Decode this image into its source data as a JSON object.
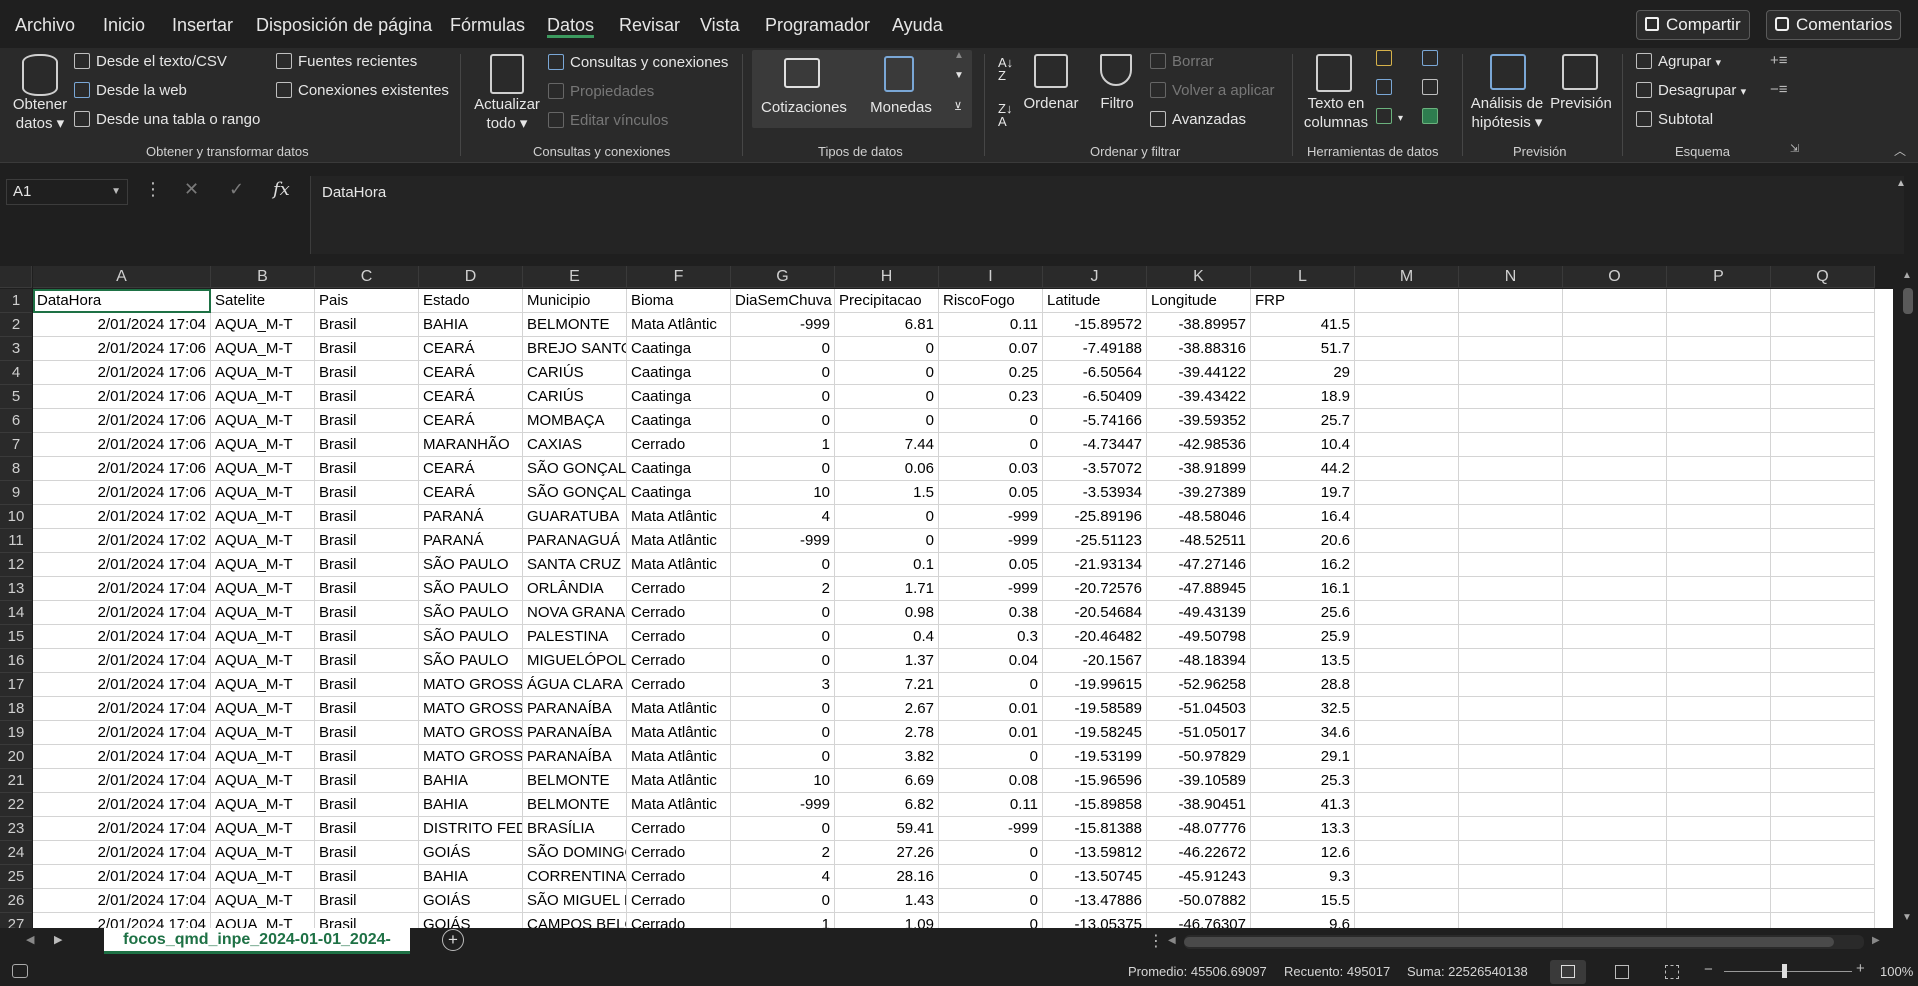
{
  "menu": {
    "tabs": [
      "Archivo",
      "Inicio",
      "Insertar",
      "Disposición de página",
      "Fórmulas",
      "Datos",
      "Revisar",
      "Vista",
      "Programador",
      "Ayuda"
    ],
    "share": "Compartir",
    "comments": "Comentarios"
  },
  "ribbon": {
    "get_data": [
      "Obtener",
      "datos"
    ],
    "from_text": "Desde el texto/CSV",
    "from_web": "Desde la web",
    "from_table": "Desde una tabla o rango",
    "recent_sources": "Fuentes recientes",
    "existing_connections": "Conexiones existentes",
    "group_get_transform": "Obtener y transformar datos",
    "refresh_all": [
      "Actualizar",
      "todo"
    ],
    "queries_connections": "Consultas y conexiones",
    "properties": "Propiedades",
    "edit_links": "Editar vínculos",
    "group_queries": "Consultas y conexiones",
    "stocks": "Cotizaciones",
    "currencies": "Monedas",
    "group_data_types": "Tipos de datos",
    "sort": "Ordenar",
    "filter": "Filtro",
    "clear": "Borrar",
    "reapply": "Volver a aplicar",
    "advanced": "Avanzadas",
    "group_sort_filter": "Ordenar y filtrar",
    "text_to_columns": [
      "Texto en",
      "columnas"
    ],
    "group_data_tools": "Herramientas de datos",
    "what_if": [
      "Análisis de",
      "hipótesis"
    ],
    "forecast_sheet": "Previsión",
    "group_forecast": "Previsión",
    "group_btn": "Agrupar",
    "ungroup_btn": "Desagrupar",
    "subtotal": "Subtotal",
    "group_outline": "Esquema"
  },
  "formula_bar": {
    "name_box": "A1",
    "content": "DataHora"
  },
  "columns": [
    "A",
    "B",
    "C",
    "D",
    "E",
    "F",
    "G",
    "H",
    "I",
    "J",
    "K",
    "L",
    "M",
    "N",
    "O",
    "P",
    "Q"
  ],
  "table": {
    "headers": [
      "DataHora",
      "Satelite",
      "Pais",
      "Estado",
      "Municipio",
      "Bioma",
      "DiaSemChuva",
      "Precipitacao",
      "RiscoFogo",
      "Latitude",
      "Longitude",
      "FRP"
    ],
    "rows": [
      [
        "2/01/2024 17:04",
        "AQUA_M-T",
        "Brasil",
        "BAHIA",
        "BELMONTE",
        "Mata Atlântic",
        "-999",
        "6.81",
        "0.11",
        "-15.89572",
        "-38.89957",
        "41.5"
      ],
      [
        "2/01/2024 17:06",
        "AQUA_M-T",
        "Brasil",
        "CEARÁ",
        "BREJO SANTO",
        "Caatinga",
        "0",
        "0",
        "0.07",
        "-7.49188",
        "-38.88316",
        "51.7"
      ],
      [
        "2/01/2024 17:06",
        "AQUA_M-T",
        "Brasil",
        "CEARÁ",
        "CARIÚS",
        "Caatinga",
        "0",
        "0",
        "0.25",
        "-6.50564",
        "-39.44122",
        "29"
      ],
      [
        "2/01/2024 17:06",
        "AQUA_M-T",
        "Brasil",
        "CEARÁ",
        "CARIÚS",
        "Caatinga",
        "0",
        "0",
        "0.23",
        "-6.50409",
        "-39.43422",
        "18.9"
      ],
      [
        "2/01/2024 17:06",
        "AQUA_M-T",
        "Brasil",
        "CEARÁ",
        "MOMBAÇA",
        "Caatinga",
        "0",
        "0",
        "0",
        "-5.74166",
        "-39.59352",
        "25.7"
      ],
      [
        "2/01/2024 17:06",
        "AQUA_M-T",
        "Brasil",
        "MARANHÃO",
        "CAXIAS",
        "Cerrado",
        "1",
        "7.44",
        "0",
        "-4.73447",
        "-42.98536",
        "10.4"
      ],
      [
        "2/01/2024 17:06",
        "AQUA_M-T",
        "Brasil",
        "CEARÁ",
        "SÃO GONÇALO",
        "Caatinga",
        "0",
        "0.06",
        "0.03",
        "-3.57072",
        "-38.91899",
        "44.2"
      ],
      [
        "2/01/2024 17:06",
        "AQUA_M-T",
        "Brasil",
        "CEARÁ",
        "SÃO GONÇALO",
        "Caatinga",
        "10",
        "1.5",
        "0.05",
        "-3.53934",
        "-39.27389",
        "19.7"
      ],
      [
        "2/01/2024 17:02",
        "AQUA_M-T",
        "Brasil",
        "PARANÁ",
        "GUARATUBA",
        "Mata Atlântic",
        "4",
        "0",
        "-999",
        "-25.89196",
        "-48.58046",
        "16.4"
      ],
      [
        "2/01/2024 17:02",
        "AQUA_M-T",
        "Brasil",
        "PARANÁ",
        "PARANAGUÁ",
        "Mata Atlântic",
        "-999",
        "0",
        "-999",
        "-25.51123",
        "-48.52511",
        "20.6"
      ],
      [
        "2/01/2024 17:04",
        "AQUA_M-T",
        "Brasil",
        "SÃO PAULO",
        "SANTA CRUZ D",
        "Mata Atlântic",
        "0",
        "0.1",
        "0.05",
        "-21.93134",
        "-47.27146",
        "16.2"
      ],
      [
        "2/01/2024 17:04",
        "AQUA_M-T",
        "Brasil",
        "SÃO PAULO",
        "ORLÂNDIA",
        "Cerrado",
        "2",
        "1.71",
        "-999",
        "-20.72576",
        "-47.88945",
        "16.1"
      ],
      [
        "2/01/2024 17:04",
        "AQUA_M-T",
        "Brasil",
        "SÃO PAULO",
        "NOVA GRANAD",
        "Cerrado",
        "0",
        "0.98",
        "0.38",
        "-20.54684",
        "-49.43139",
        "25.6"
      ],
      [
        "2/01/2024 17:04",
        "AQUA_M-T",
        "Brasil",
        "SÃO PAULO",
        "PALESTINA",
        "Cerrado",
        "0",
        "0.4",
        "0.3",
        "-20.46482",
        "-49.50798",
        "25.9"
      ],
      [
        "2/01/2024 17:04",
        "AQUA_M-T",
        "Brasil",
        "SÃO PAULO",
        "MIGUELÓPOLIS",
        "Cerrado",
        "0",
        "1.37",
        "0.04",
        "-20.1567",
        "-48.18394",
        "13.5"
      ],
      [
        "2/01/2024 17:04",
        "AQUA_M-T",
        "Brasil",
        "MATO GROSSO",
        "ÁGUA CLARA",
        "Cerrado",
        "3",
        "7.21",
        "0",
        "-19.99615",
        "-52.96258",
        "28.8"
      ],
      [
        "2/01/2024 17:04",
        "AQUA_M-T",
        "Brasil",
        "MATO GROSSO",
        "PARANAÍBA",
        "Mata Atlântic",
        "0",
        "2.67",
        "0.01",
        "-19.58589",
        "-51.04503",
        "32.5"
      ],
      [
        "2/01/2024 17:04",
        "AQUA_M-T",
        "Brasil",
        "MATO GROSSO",
        "PARANAÍBA",
        "Mata Atlântic",
        "0",
        "2.78",
        "0.01",
        "-19.58245",
        "-51.05017",
        "34.6"
      ],
      [
        "2/01/2024 17:04",
        "AQUA_M-T",
        "Brasil",
        "MATO GROSSO",
        "PARANAÍBA",
        "Mata Atlântic",
        "0",
        "3.82",
        "0",
        "-19.53199",
        "-50.97829",
        "29.1"
      ],
      [
        "2/01/2024 17:04",
        "AQUA_M-T",
        "Brasil",
        "BAHIA",
        "BELMONTE",
        "Mata Atlântic",
        "10",
        "6.69",
        "0.08",
        "-15.96596",
        "-39.10589",
        "25.3"
      ],
      [
        "2/01/2024 17:04",
        "AQUA_M-T",
        "Brasil",
        "BAHIA",
        "BELMONTE",
        "Mata Atlântic",
        "-999",
        "6.82",
        "0.11",
        "-15.89858",
        "-38.90451",
        "41.3"
      ],
      [
        "2/01/2024 17:04",
        "AQUA_M-T",
        "Brasil",
        "DISTRITO FEDE",
        "BRASÍLIA",
        "Cerrado",
        "0",
        "59.41",
        "-999",
        "-15.81388",
        "-48.07776",
        "13.3"
      ],
      [
        "2/01/2024 17:04",
        "AQUA_M-T",
        "Brasil",
        "GOIÁS",
        "SÃO DOMINGO",
        "Cerrado",
        "2",
        "27.26",
        "0",
        "-13.59812",
        "-46.22672",
        "12.6"
      ],
      [
        "2/01/2024 17:04",
        "AQUA_M-T",
        "Brasil",
        "BAHIA",
        "CORRENTINA",
        "Cerrado",
        "4",
        "28.16",
        "0",
        "-13.50745",
        "-45.91243",
        "9.3"
      ],
      [
        "2/01/2024 17:04",
        "AQUA_M-T",
        "Brasil",
        "GOIÁS",
        "SÃO MIGUEL D",
        "Cerrado",
        "0",
        "1.43",
        "0",
        "-13.47886",
        "-50.07882",
        "15.5"
      ],
      [
        "2/01/2024 17:04",
        "AQUA_M-T",
        "Brasil",
        "GOIÁS",
        "CAMPOS BELOS",
        "Cerrado",
        "1",
        "1.09",
        "0",
        "-13.05375",
        "-46.76307",
        "9.6"
      ]
    ]
  },
  "sheet_tab": "focos_qmd_inpe_2024-01-01_2024-",
  "status": {
    "average": "Promedio: 45506.69097",
    "count": "Recuento: 495017",
    "sum": "Suma: 22526540138",
    "zoom": "100%"
  }
}
